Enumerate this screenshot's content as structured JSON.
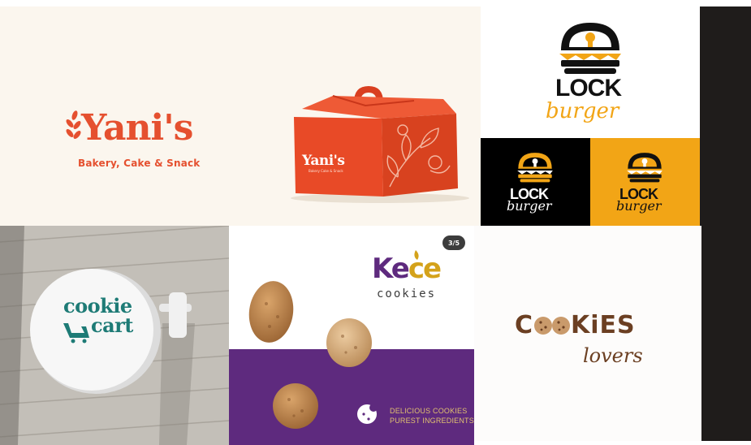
{
  "colors": {
    "yanis_red": "#e5502f",
    "yanis_bg": "#fbf6ee",
    "burger_yellow": "#f2a516",
    "kece_purple": "#5e2a7e",
    "kece_gold": "#d4a21a",
    "cart_teal": "#1e7b76",
    "lovers_brown": "#6b3f22",
    "dark_strip": "#1f1c1b"
  },
  "yanis": {
    "name": "Yani's",
    "tagline": "Bakery, Cake & Snack",
    "box_name": "Yani's",
    "box_tagline": "Bakery Cake & Snack"
  },
  "lockburger": {
    "word1": "LOCK",
    "word2": "burger"
  },
  "cookiecart": {
    "word1": "cookie",
    "word2": "cart"
  },
  "kece": {
    "page_badge": "3/5",
    "brand_k": "K",
    "brand_e": "e",
    "brand_ce": "ce",
    "sub": "cookies",
    "slogan_line1": "DELICIOUS COOKIES",
    "slogan_line2": "PUREST INGREDIENTS"
  },
  "cookieslovers": {
    "word1_pre": "C",
    "word1_post": "KiES",
    "word2": "lovers"
  }
}
